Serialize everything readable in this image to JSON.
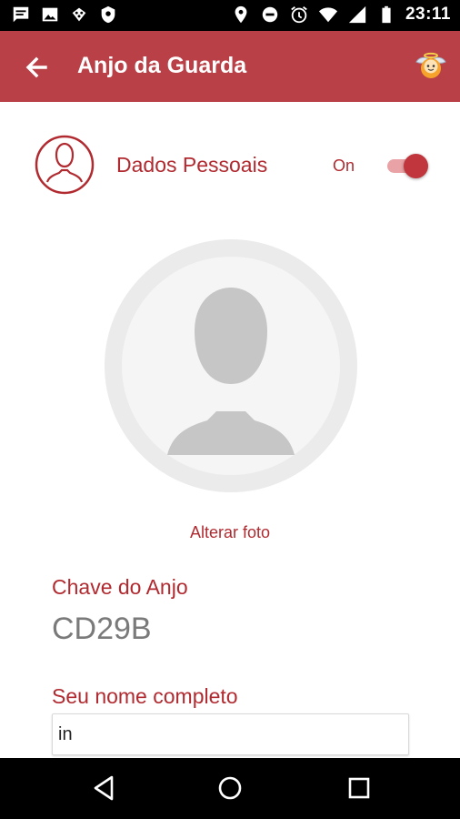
{
  "status_bar": {
    "time": "23:11",
    "left_icons": [
      "message-icon",
      "image-icon",
      "dice-icon",
      "shield-icon"
    ],
    "right_icons": [
      "location-icon",
      "do-not-disturb-icon",
      "alarm-icon",
      "wifi-icon",
      "signal-icon",
      "battery-icon"
    ]
  },
  "app_bar": {
    "title": "Anjo da Guarda",
    "back_icon": "arrow-back-icon",
    "logo_icon": "angel-logo-icon",
    "color": "#b94047"
  },
  "personal_data": {
    "title": "Dados Pessoais",
    "toggle_label": "On",
    "toggle_on": true
  },
  "photo": {
    "change_label": "Alterar foto"
  },
  "angel_key": {
    "label": "Chave do Anjo",
    "value": "CD29B"
  },
  "full_name": {
    "label": "Seu nome completo",
    "value": "in"
  },
  "nav_bar": {
    "icons": [
      "back-triangle-icon",
      "home-circle-icon",
      "recents-square-icon"
    ]
  },
  "colors": {
    "accent": "#b02a30",
    "toolbar": "#b94047",
    "muted_text": "#7a7a7a"
  }
}
